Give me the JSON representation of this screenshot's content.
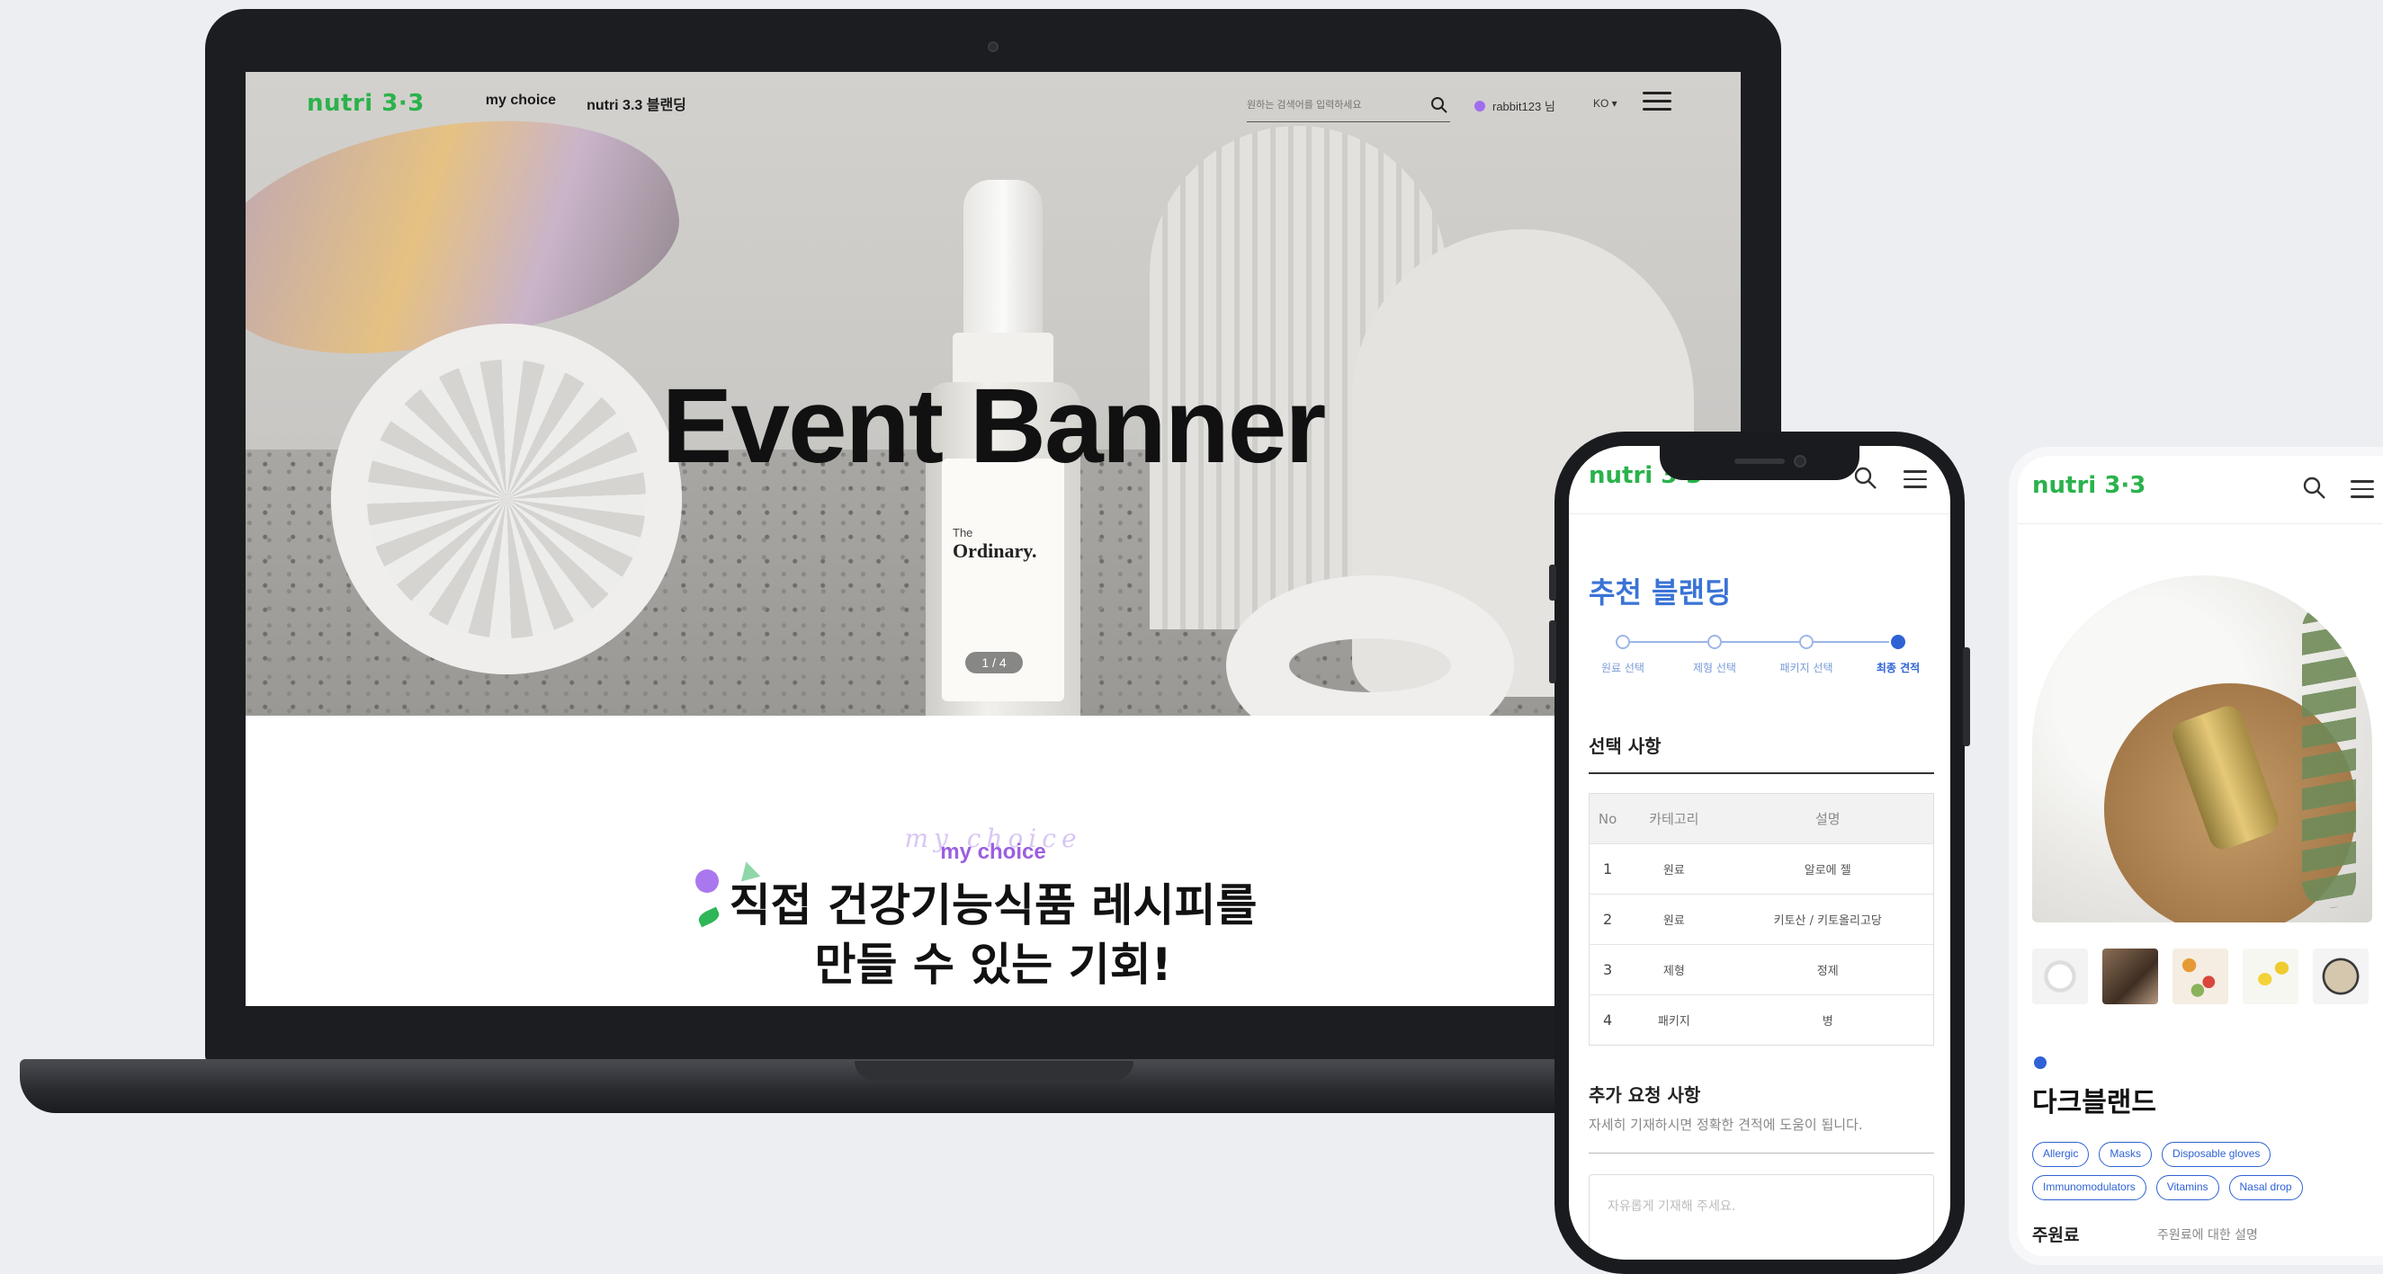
{
  "desktop": {
    "logo": "nutri 3·3",
    "nav": [
      "my choice",
      "nutri 3.3 블랜딩"
    ],
    "search_placeholder": "원하는 검색어를 입력하세요",
    "user": "rabbit123 님",
    "language": "KO ▾",
    "hero": {
      "title": "Event Banner",
      "slide_counter": "1 / 4",
      "product_label_the": "The",
      "product_label_brand": "Ordinary."
    },
    "section": {
      "script": "my choice",
      "kicker": "my choice",
      "headline_line1": "직접 건강기능식품 레시피를",
      "headline_line2": "만들 수 있는 기회!"
    }
  },
  "mobile_blending": {
    "logo": "nutri 3·3",
    "title": "추천 블랜딩",
    "steps": [
      {
        "label": "원료 선택",
        "active": false
      },
      {
        "label": "제형 선택",
        "active": false
      },
      {
        "label": "패키지 선택",
        "active": false
      },
      {
        "label": "최종 견적",
        "active": true
      }
    ],
    "selection_title": "선택 사항",
    "table": {
      "headers": [
        "No",
        "카테고리",
        "설명"
      ],
      "rows": [
        [
          "1",
          "원료",
          "알로에 젤"
        ],
        [
          "2",
          "원료",
          "키토산 / 키토올리고당"
        ],
        [
          "3",
          "제형",
          "정제"
        ],
        [
          "4",
          "패키지",
          "병"
        ]
      ]
    },
    "request_title": "추가 요청 사항",
    "request_subtitle": "자세히 기재하시면 정확한 견적에 도움이 됩니다.",
    "request_placeholder": "자유롭게 기재해 주세요."
  },
  "mobile_product": {
    "logo": "nutri 3·3",
    "brand_name": "다크블랜드",
    "tags": [
      "Allergic",
      "Masks",
      "Disposable gloves",
      "Immunomodulators",
      "Vitamins",
      "Nasal drop"
    ],
    "ingredient_label": "주원료",
    "ingredient_desc": "주원료에 대한 설명"
  },
  "colors": {
    "brand_green": "#2bb24c",
    "accent_purple": "#9b5fe0",
    "accent_blue": "#2f62d5",
    "step_inactive": "#9db6e8"
  },
  "icons": [
    "search-icon",
    "hamburger-menu-icon",
    "user-status-dot-icon"
  ]
}
